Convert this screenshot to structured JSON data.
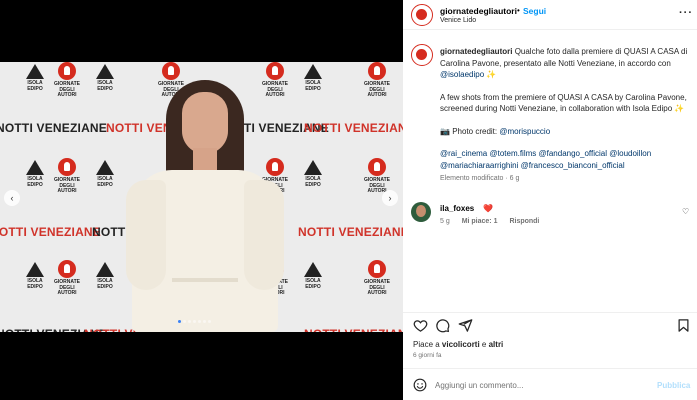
{
  "header": {
    "username": "giornatedegliautori",
    "separator": "•",
    "follow_label": "Segui",
    "location": "Venice Lido",
    "more_icon": "more-horizontal-icon"
  },
  "media": {
    "backdrop": {
      "giornate_text": [
        "GIORNATE",
        "DEGLI",
        "AUTORI"
      ],
      "isola_text": [
        "ISOLA",
        "EDIPO"
      ],
      "notti_text": "NOTTI VENEZIANE"
    },
    "carousel": {
      "dot_count": 7,
      "active_index": 0
    }
  },
  "caption": {
    "username": "giornatedegliautori",
    "italian": "Qualche foto dalla premiere di QUASI A CASA di Carolina Pavone, presentato alle Notti Veneziane, in accordo con ",
    "italian_mention": "@isolaedipo",
    "english": "A few shots from the premiere of QUASI A CASA by Carolina Pavone, screened during Notti Veneziane, in collaboration with Isola Edipo",
    "photo_credit_label": "Photo credit: ",
    "photo_credit_mention": "@morispuccio",
    "mentions": [
      "@rai_cinema",
      "@totem.films",
      "@fandango_official",
      "@loudoillon",
      "@mariachiaraarrighini",
      "@francesco_bianconi_official"
    ],
    "edited": "Elemento modificato · 6 g"
  },
  "comment": {
    "username": "ila_foxes",
    "text": "❤️",
    "age": "5 g",
    "likes": "Mi piace: 1",
    "reply_label": "Rispondi"
  },
  "actions": {
    "likes_prefix": "Piace a ",
    "likes_user": "vicolicorti",
    "likes_suffix": " e ",
    "likes_others": "altri",
    "date": "6 giorni fa"
  },
  "add_comment": {
    "placeholder": "Aggiungi un commento...",
    "publish_label": "Pubblica"
  }
}
